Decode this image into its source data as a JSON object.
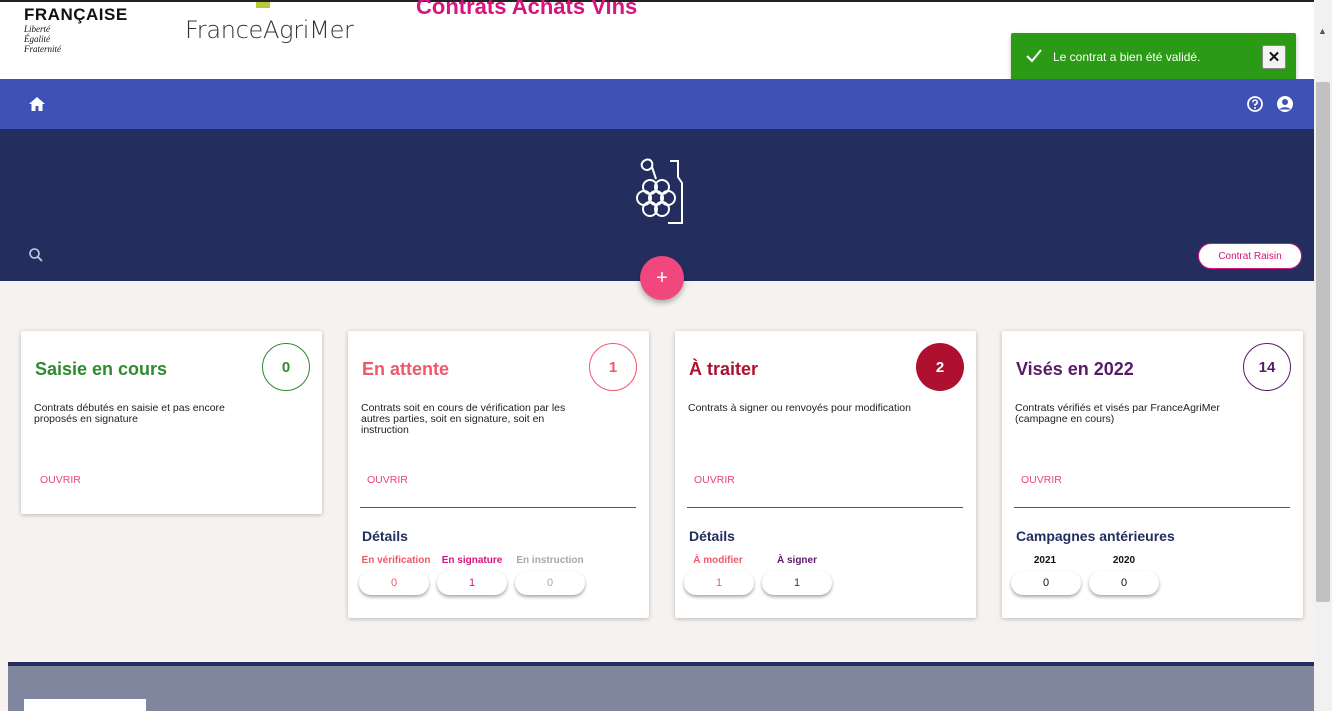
{
  "header": {
    "rf_name": "FRANÇAISE",
    "rf_motto": [
      "Liberté",
      "Égalité",
      "Fraternité"
    ],
    "org_name": "FranceAgriMer",
    "app_title": "Contrats Achats Vins"
  },
  "toast": {
    "message": "Le contrat a bien été validé.",
    "close_label": "✕",
    "color": "#2b9a14"
  },
  "nav": {
    "home_icon": "home-icon",
    "help_icon": "help-icon",
    "user_icon": "user-icon",
    "color": "#3e51b5"
  },
  "banner": {
    "raisin_button": "Contrat Raisin",
    "add_button": "+",
    "color": "#232e5f"
  },
  "cards": [
    {
      "title": "Saisie en cours",
      "count": "0",
      "description": "Contrats débutés en saisie et pas encore proposés en signature",
      "open_label": "OUVRIR",
      "accent": "#2e8b2e"
    },
    {
      "title": "En attente",
      "count": "1",
      "description": "Contrats soit en cours de vérification par les autres parties, soit en signature, soit en instruction",
      "open_label": "OUVRIR",
      "accent": "#f0586a",
      "details_title": "Détails",
      "details": [
        {
          "label": "En vérification",
          "value": "0",
          "color": "#f0586a"
        },
        {
          "label": "En signature",
          "value": "1",
          "color": "#d6147e"
        },
        {
          "label": "En instruction",
          "value": "0",
          "color": "#a8a8a8"
        }
      ]
    },
    {
      "title": "À traiter",
      "count": "2",
      "description": "Contrats à signer ou renvoyés pour modification",
      "open_label": "OUVRIR",
      "accent": "#b0102f",
      "details_title": "Détails",
      "details": [
        {
          "label": "À modifier",
          "value": "1",
          "color": "#f0586a"
        },
        {
          "label": "À signer",
          "value": "1",
          "color": "#5a1a6a"
        }
      ]
    },
    {
      "title": "Visés en 2022",
      "count": "14",
      "description": "Contrats vérifiés et visés par FranceAgriMer (campagne en cours)",
      "open_label": "OUVRIR",
      "accent": "#5a1a6a",
      "details_title": "Campagnes antérieures",
      "details": [
        {
          "label": "2021",
          "value": "0",
          "color": "#111111"
        },
        {
          "label": "2020",
          "value": "0",
          "color": "#111111"
        }
      ]
    }
  ]
}
